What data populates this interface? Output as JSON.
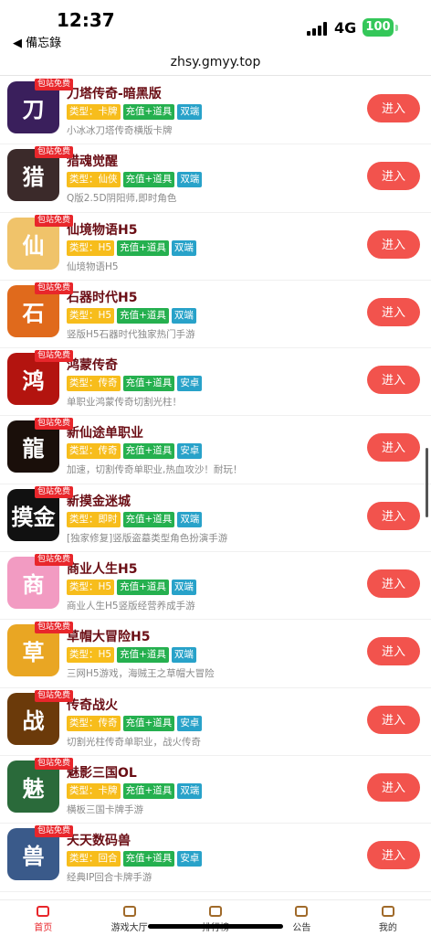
{
  "status_bar": {
    "time": "12:37",
    "back_label": "◀ 備忘錄",
    "network": "4G",
    "battery": "100"
  },
  "url": "zhsy.gmyy.top",
  "free_badge": "包站免费",
  "enter_label": "进入",
  "games": [
    {
      "name": "刀塔传奇-暗黑版",
      "type": "类型：卡牌",
      "pay": "充值+道具",
      "platform": "双端",
      "desc": "小冰冰刀塔传奇横版卡牌",
      "icon_text": "刀",
      "icon_color": "#3a1f5c"
    },
    {
      "name": "猎魂觉醒",
      "type": "类型：仙侠",
      "pay": "充值+道具",
      "platform": "双端",
      "desc": "Q版2.5D阴阳师,即时角色",
      "icon_text": "猎",
      "icon_color": "#3b2a2a"
    },
    {
      "name": "仙境物语H5",
      "type": "类型：H5",
      "pay": "充值+道具",
      "platform": "双端",
      "desc": "仙境物语H5",
      "icon_text": "仙",
      "icon_color": "#f0c36a"
    },
    {
      "name": "石器时代H5",
      "type": "类型：H5",
      "pay": "充值+道具",
      "platform": "双端",
      "desc": "竖版H5石器时代独家热门手游",
      "icon_text": "石",
      "icon_color": "#e06a1c"
    },
    {
      "name": "鸿蒙传奇",
      "type": "类型：传奇",
      "pay": "充值+道具",
      "platform": "安卓",
      "desc": "单职业鸿蒙传奇切割光柱！",
      "icon_text": "鸿",
      "icon_color": "#b3140f"
    },
    {
      "name": "新仙途单职业",
      "type": "类型：传奇",
      "pay": "充值+道具",
      "platform": "安卓",
      "desc": "加速，切割传奇单职业,热血攻沙！耐玩！",
      "icon_text": "龍",
      "icon_color": "#1a0f0a"
    },
    {
      "name": "新摸金迷城",
      "type": "类型：即时",
      "pay": "充值+道具",
      "platform": "双端",
      "desc": "[独家修复]竖版盗墓类型角色扮演手游",
      "icon_text": "摸金",
      "icon_color": "#111111"
    },
    {
      "name": "商业人生H5",
      "type": "类型：H5",
      "pay": "充值+道具",
      "platform": "双端",
      "desc": "商业人生H5竖版经营养成手游",
      "icon_text": "商",
      "icon_color": "#f29bc2"
    },
    {
      "name": "草帽大冒险H5",
      "type": "类型：H5",
      "pay": "充值+道具",
      "platform": "双端",
      "desc": "三网H5游戏，海贼王之草帽大冒险",
      "icon_text": "草",
      "icon_color": "#e9a623"
    },
    {
      "name": "传奇战火",
      "type": "类型：传奇",
      "pay": "充值+道具",
      "platform": "安卓",
      "desc": "切割光柱传奇单职业，战火传奇",
      "icon_text": "战",
      "icon_color": "#6b3a0a"
    },
    {
      "name": "魅影三国OL",
      "type": "类型：卡牌",
      "pay": "充值+道具",
      "platform": "双端",
      "desc": "横板三国卡牌手游",
      "icon_text": "魅",
      "icon_color": "#2a6a3a"
    },
    {
      "name": "天天数码兽",
      "type": "类型：回合",
      "pay": "充值+道具",
      "platform": "安卓",
      "desc": "经典IP回合卡牌手游",
      "icon_text": "兽",
      "icon_color": "#3a5a8a"
    }
  ],
  "nav": [
    {
      "label": "首页",
      "active": true
    },
    {
      "label": "游戏大厅",
      "active": false
    },
    {
      "label": "排行榜",
      "active": false
    },
    {
      "label": "公告",
      "active": false
    },
    {
      "label": "我的",
      "active": false
    }
  ]
}
